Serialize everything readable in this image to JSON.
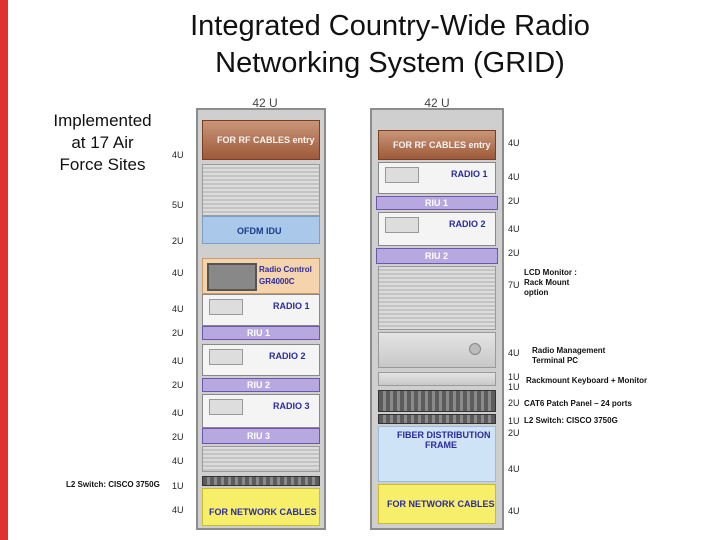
{
  "title": {
    "line1": "Integrated Country-Wide Radio",
    "line2": "Networking System (GRID)"
  },
  "note": {
    "line1": "Implemented",
    "line2": "at 17 Air",
    "line3": "Force Sites"
  },
  "left_rack": {
    "height_label": "42 U",
    "rf_entry": "FOR RF CABLES entry",
    "ofdm": "OFDM IDU",
    "radio_control": "Radio Control",
    "radio_control_model": "GR4000C",
    "radio1": "RADIO 1",
    "riu1": "RIU 1",
    "radio2": "RADIO 2",
    "riu2": "RIU 2",
    "radio3": "RADIO 3",
    "riu3": "RIU 3",
    "network_cables": "FOR NETWORK CABLES",
    "switch_note": "L2 Switch: CISCO 3750G",
    "units": [
      "4U",
      "5U",
      "2U",
      "4U",
      "4U",
      "2U",
      "4U",
      "2U",
      "4U",
      "2U",
      "4U",
      "1U",
      "4U"
    ]
  },
  "right_rack": {
    "height_label": "42 U",
    "rf_entry": "FOR RF CABLES entry",
    "radio1": "RADIO 1",
    "riu1": "RIU 1",
    "radio2": "RADIO 2",
    "riu2": "RIU 2",
    "fiber_line1": "FIBER DISTRIBUTION",
    "fiber_line2": "FRAME",
    "network_cables": "FOR NETWORK CABLES",
    "units": [
      "4U",
      "4U",
      "2U",
      "4U",
      "2U",
      "7U",
      "4U",
      "1U",
      "1U",
      "2U",
      "1U",
      "2U",
      "4U",
      "4U"
    ],
    "annotations": {
      "lcd_line1": "LCD Monitor :",
      "lcd_line2": "Rack Mount",
      "lcd_line3": "option",
      "rmt_line1": "Radio Management",
      "rmt_line2": "Terminal PC",
      "keyboard": "Rackmount Keyboard + Monitor",
      "patch": "CAT6 Patch Panel – 24 ports",
      "switch": "L2 Switch: CISCO 3750G"
    }
  },
  "colors": {
    "accent_bar": "#e0312f",
    "riu": "#b8a8e0",
    "ofdm": "#a9c8ea",
    "network": "#f7ef6a",
    "rf": "#9e5a3a"
  }
}
